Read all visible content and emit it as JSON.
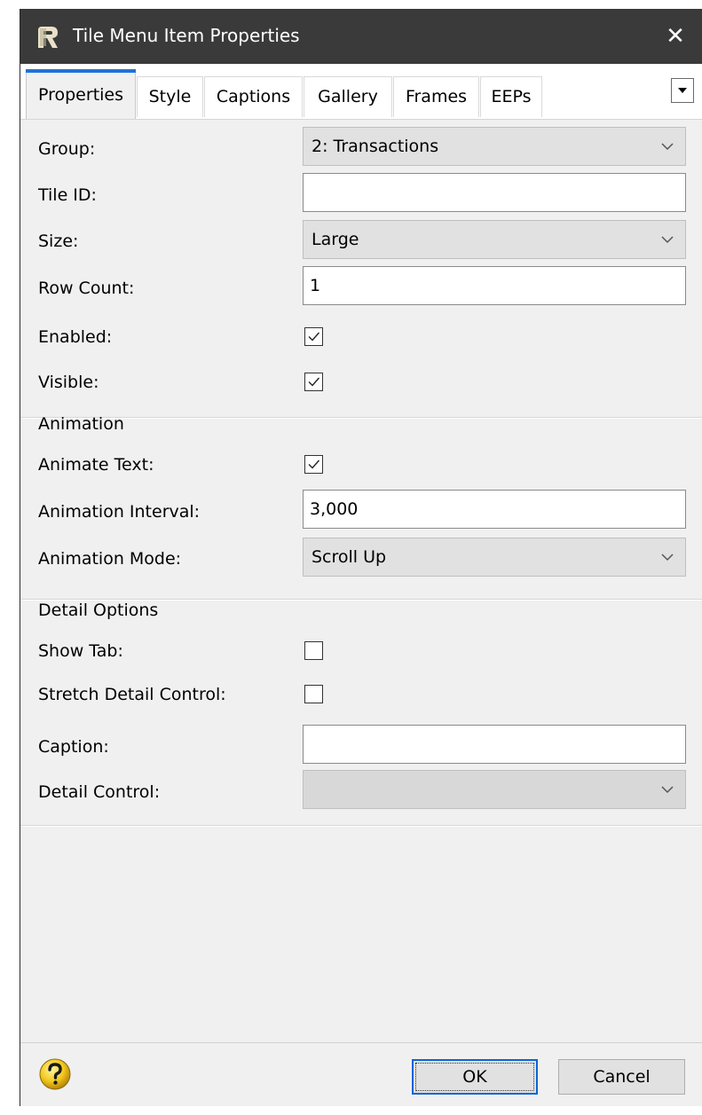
{
  "window": {
    "title": "Tile Menu Item Properties",
    "close_glyph": "✕",
    "icon": "app-r-icon"
  },
  "tabs": [
    {
      "label": "Properties",
      "active": true
    },
    {
      "label": "Style",
      "active": false
    },
    {
      "label": "Captions",
      "active": false
    },
    {
      "label": "Gallery",
      "active": false
    },
    {
      "label": "Frames",
      "active": false
    },
    {
      "label": "EEPs",
      "active": false
    }
  ],
  "properties": {
    "group": {
      "label": "Group:",
      "value": "2: Transactions"
    },
    "tile_id": {
      "label": "Tile ID:",
      "value": ""
    },
    "size": {
      "label": "Size:",
      "value": "Large"
    },
    "row_count": {
      "label": "Row Count:",
      "value": "1"
    },
    "enabled": {
      "label": "Enabled:",
      "checked": true
    },
    "visible": {
      "label": "Visible:",
      "checked": true
    }
  },
  "animation": {
    "section_title": "Animation",
    "animate_text": {
      "label": "Animate Text:",
      "checked": true
    },
    "interval": {
      "label": "Animation Interval:",
      "value": "3,000"
    },
    "mode": {
      "label": "Animation Mode:",
      "value": "Scroll Up"
    }
  },
  "detail_options": {
    "section_title": "Detail Options",
    "show_tab": {
      "label": "Show Tab:",
      "checked": false
    },
    "stretch": {
      "label": "Stretch Detail Control:",
      "checked": false
    },
    "caption": {
      "label": "Caption:",
      "value": ""
    },
    "detail_control": {
      "label": "Detail Control:",
      "value": ""
    }
  },
  "footer": {
    "ok_label": "OK",
    "cancel_label": "Cancel"
  },
  "colors": {
    "titlebar": "#3a3a3a",
    "dialog_bg": "#f0f0f0",
    "active_tab_accent": "#1e73d8",
    "default_button_border": "#0a64d8"
  }
}
